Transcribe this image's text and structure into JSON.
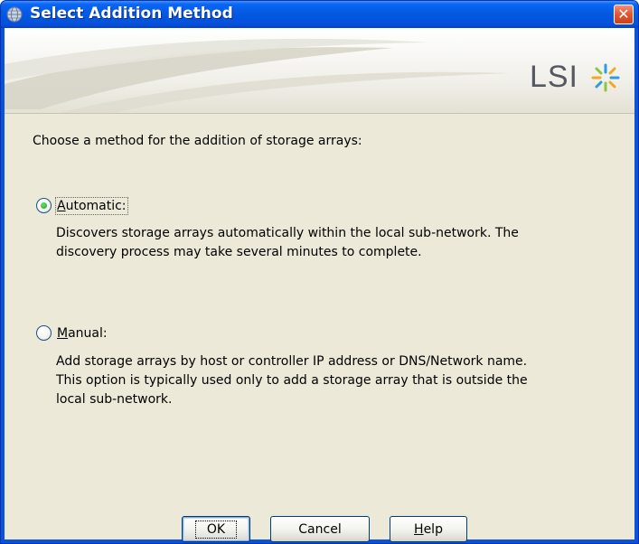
{
  "window": {
    "title": "Select Addition Method",
    "close_symbol": "✕",
    "title_icon": "globe-icon",
    "colors": {
      "titlebar": "#0358e0",
      "client": "#ece9d8",
      "close": "#e05a37"
    }
  },
  "banner": {
    "logo_text": "LSI",
    "logo_mark": "lsi-star-logo"
  },
  "dialog": {
    "prompt": "Choose a method for the addition of storage arrays:",
    "options": [
      {
        "mnemonic": "A",
        "label_rest": "utomatic:",
        "checked": true,
        "description_lines": [
          "Discovers storage arrays automatically within the local sub-network. The",
          "discovery process may take several minutes to complete."
        ]
      },
      {
        "mnemonic": "M",
        "label_rest": "anual:",
        "checked": false,
        "description_lines": [
          "Add storage arrays by host or controller IP address or DNS/Network name.",
          "This option is typically used only to add a storage array that is outside the",
          "local sub-network."
        ]
      }
    ]
  },
  "buttons": {
    "ok": "OK",
    "cancel": "Cancel",
    "help_mnemonic": "H",
    "help_rest": "elp"
  }
}
